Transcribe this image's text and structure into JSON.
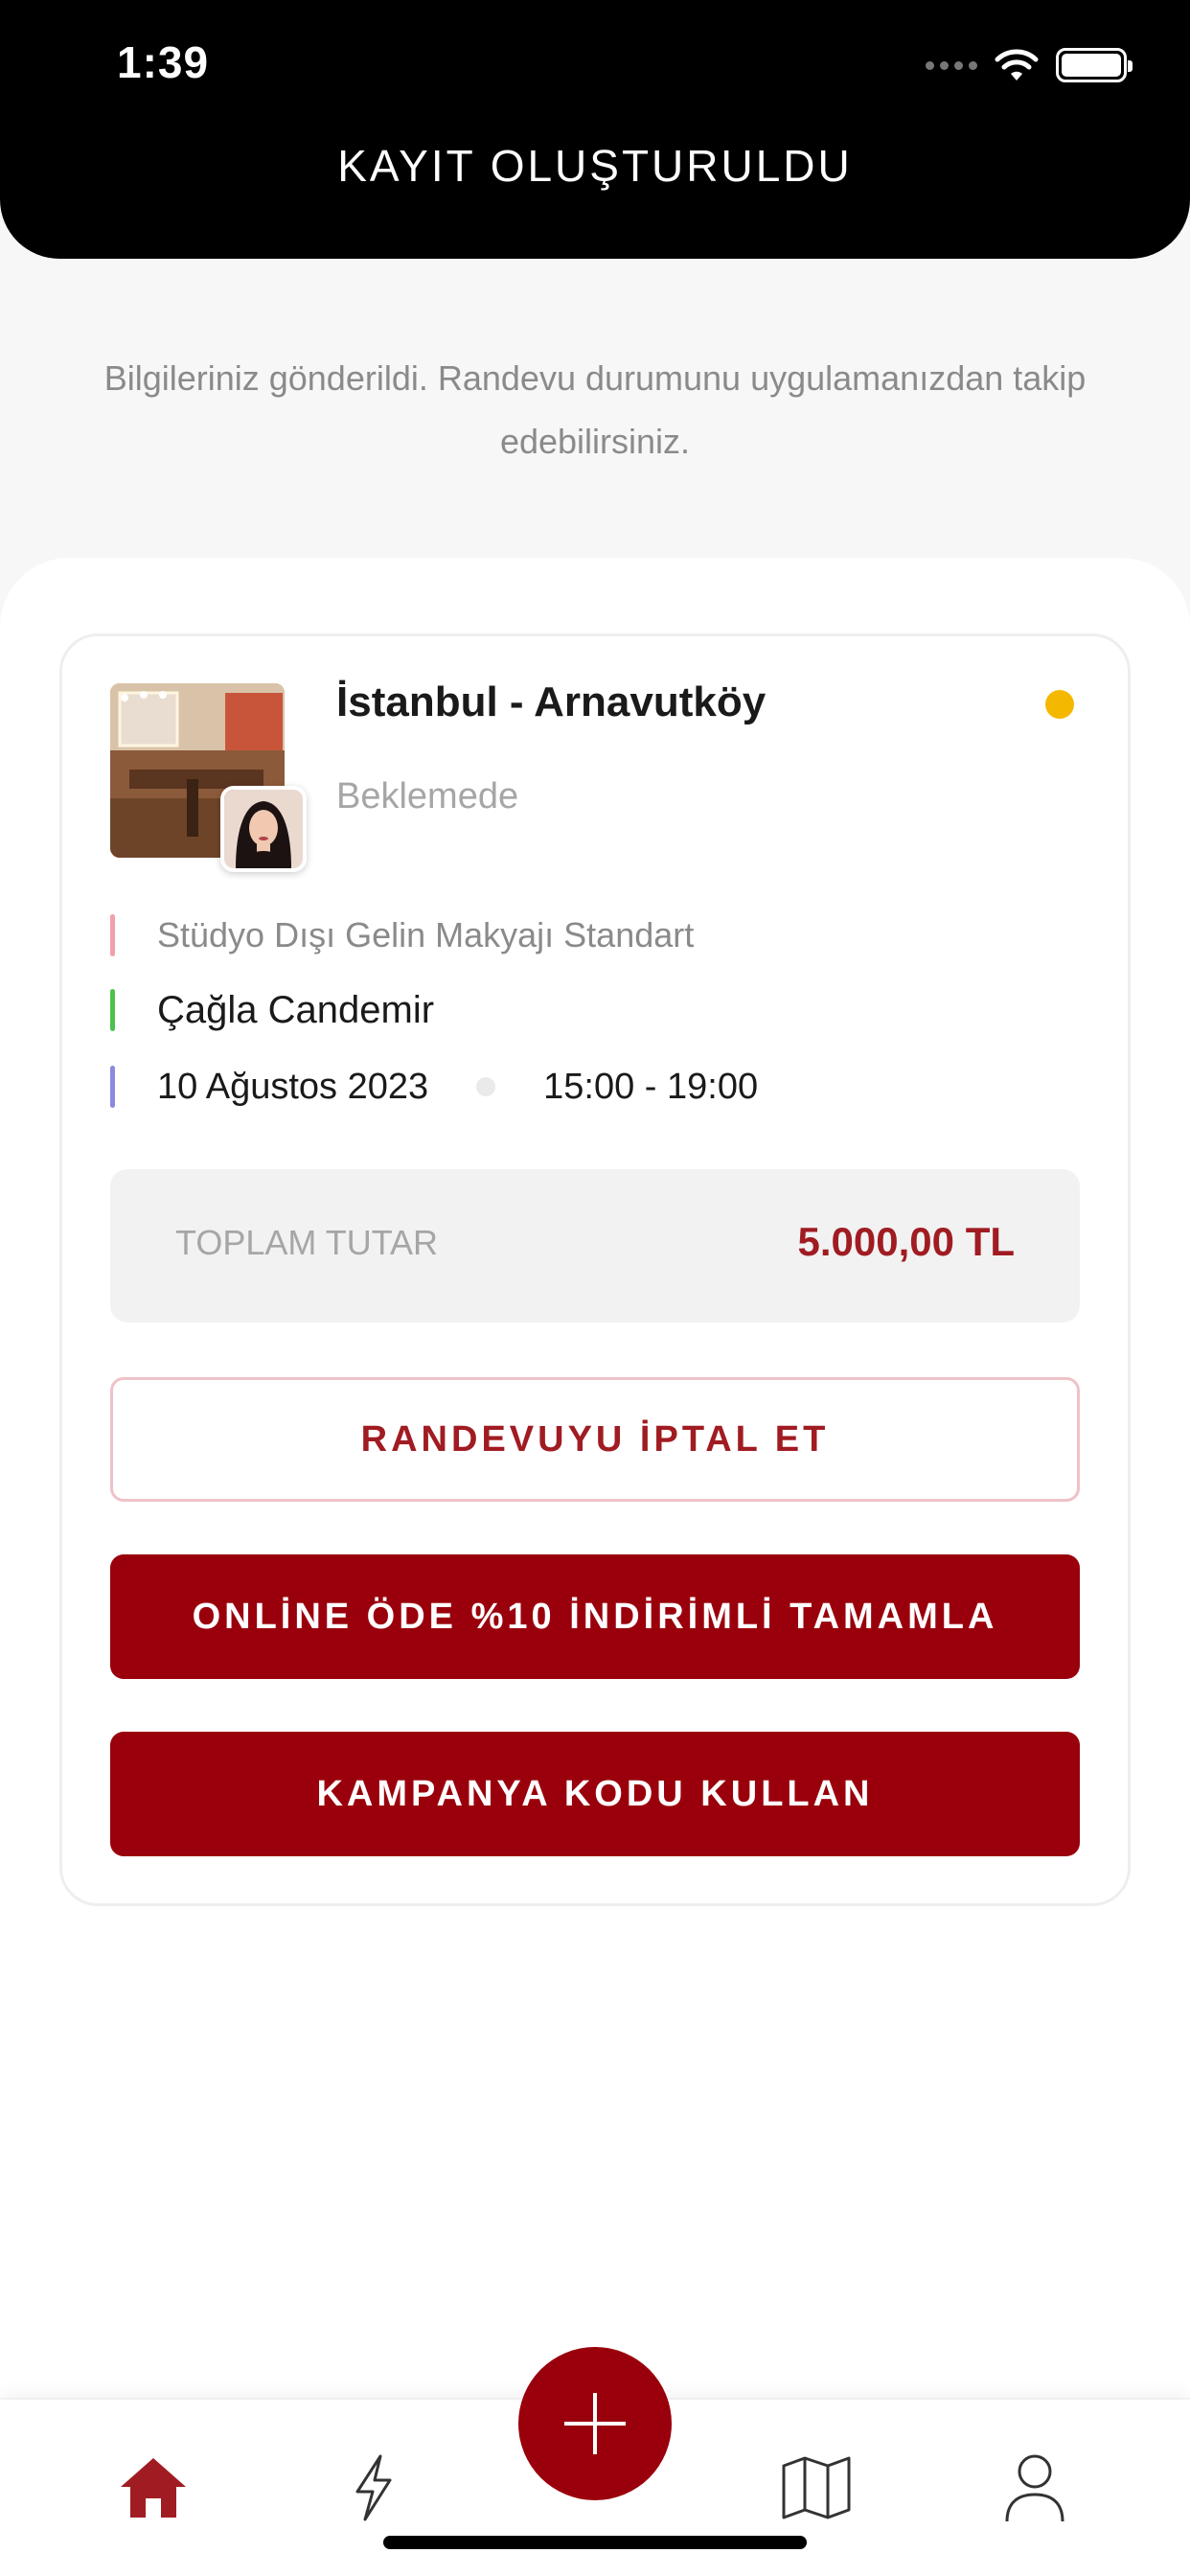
{
  "status_bar": {
    "time": "1:39"
  },
  "header": {
    "title": "KAYIT OLUŞTURULDU"
  },
  "info": {
    "message": "Bilgileriniz gönderildi. Randevu durumunu uygulamanızdan takip edebilirsiniz."
  },
  "booking": {
    "location": "İstanbul - Arnavutköy",
    "status": "Beklemede",
    "status_color": "#f5b800",
    "service": "Stüdyo Dışı Gelin Makyajı Standart",
    "artist": "Çağla Candemir",
    "date": "10 Ağustos 2023",
    "time": "15:00 - 19:00",
    "total_label": "TOPLAM TUTAR",
    "total_value": "5.000,00 TL"
  },
  "actions": {
    "cancel_label": "RANDEVUYU İPTAL ET",
    "pay_label": "ONLİNE ÖDE %10 İNDİRİMLİ TAMAMLA",
    "promo_label": "KAMPANYA KODU KULLAN"
  },
  "tabbar": {
    "items": [
      "home-icon",
      "lightning-icon",
      "plus-icon",
      "map-icon",
      "user-icon"
    ],
    "active": "home-icon"
  },
  "colors": {
    "brand": "#9a000c",
    "accent_text": "#a01c22",
    "bar_service": "#f0a0a8",
    "bar_artist": "#4cc24c",
    "bar_date": "#8a8ae0"
  }
}
